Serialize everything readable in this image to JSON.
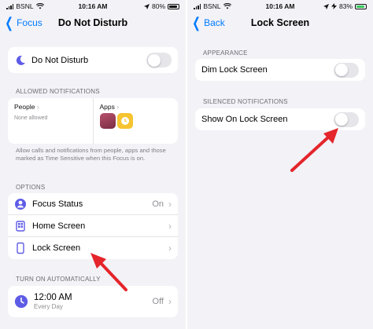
{
  "left": {
    "status": {
      "carrier": "BSNL",
      "time": "10:16 AM",
      "battery": "80%"
    },
    "nav": {
      "back_label": "Focus",
      "title": "Do Not Disturb"
    },
    "dnd": {
      "label": "Do Not Disturb"
    },
    "allowed": {
      "header": "ALLOWED NOTIFICATIONS",
      "people_label": "People",
      "people_value": "None allowed",
      "apps_label": "Apps",
      "note": "Allow calls and notifications from people, apps and those marked as Time Sensitive when this Focus is on."
    },
    "options": {
      "header": "OPTIONS",
      "items": [
        {
          "label": "Focus Status",
          "value": "On"
        },
        {
          "label": "Home Screen",
          "value": ""
        },
        {
          "label": "Lock Screen",
          "value": ""
        }
      ]
    },
    "auto": {
      "header": "TURN ON AUTOMATICALLY",
      "time": "12:00 AM",
      "repeat": "Every Day",
      "value": "Off"
    }
  },
  "right": {
    "status": {
      "carrier": "BSNL",
      "time": "10:16 AM",
      "battery": "83%"
    },
    "nav": {
      "back_label": "Back",
      "title": "Lock Screen"
    },
    "appearance": {
      "header": "APPEARANCE",
      "dim_label": "Dim Lock Screen"
    },
    "silenced": {
      "header": "SILENCED NOTIFICATIONS",
      "show_label": "Show On Lock Screen"
    }
  },
  "colors": {
    "accent": "#007aff",
    "annotation_arrow": "#e4252b",
    "dnd_moon": "#5e5ce6"
  },
  "icons": [
    "moon-icon",
    "focus-status-icon",
    "home-screen-icon",
    "lock-screen-icon",
    "clock-icon",
    "chevron-right-icon",
    "wifi-icon",
    "signal-icon",
    "battery-icon"
  ]
}
